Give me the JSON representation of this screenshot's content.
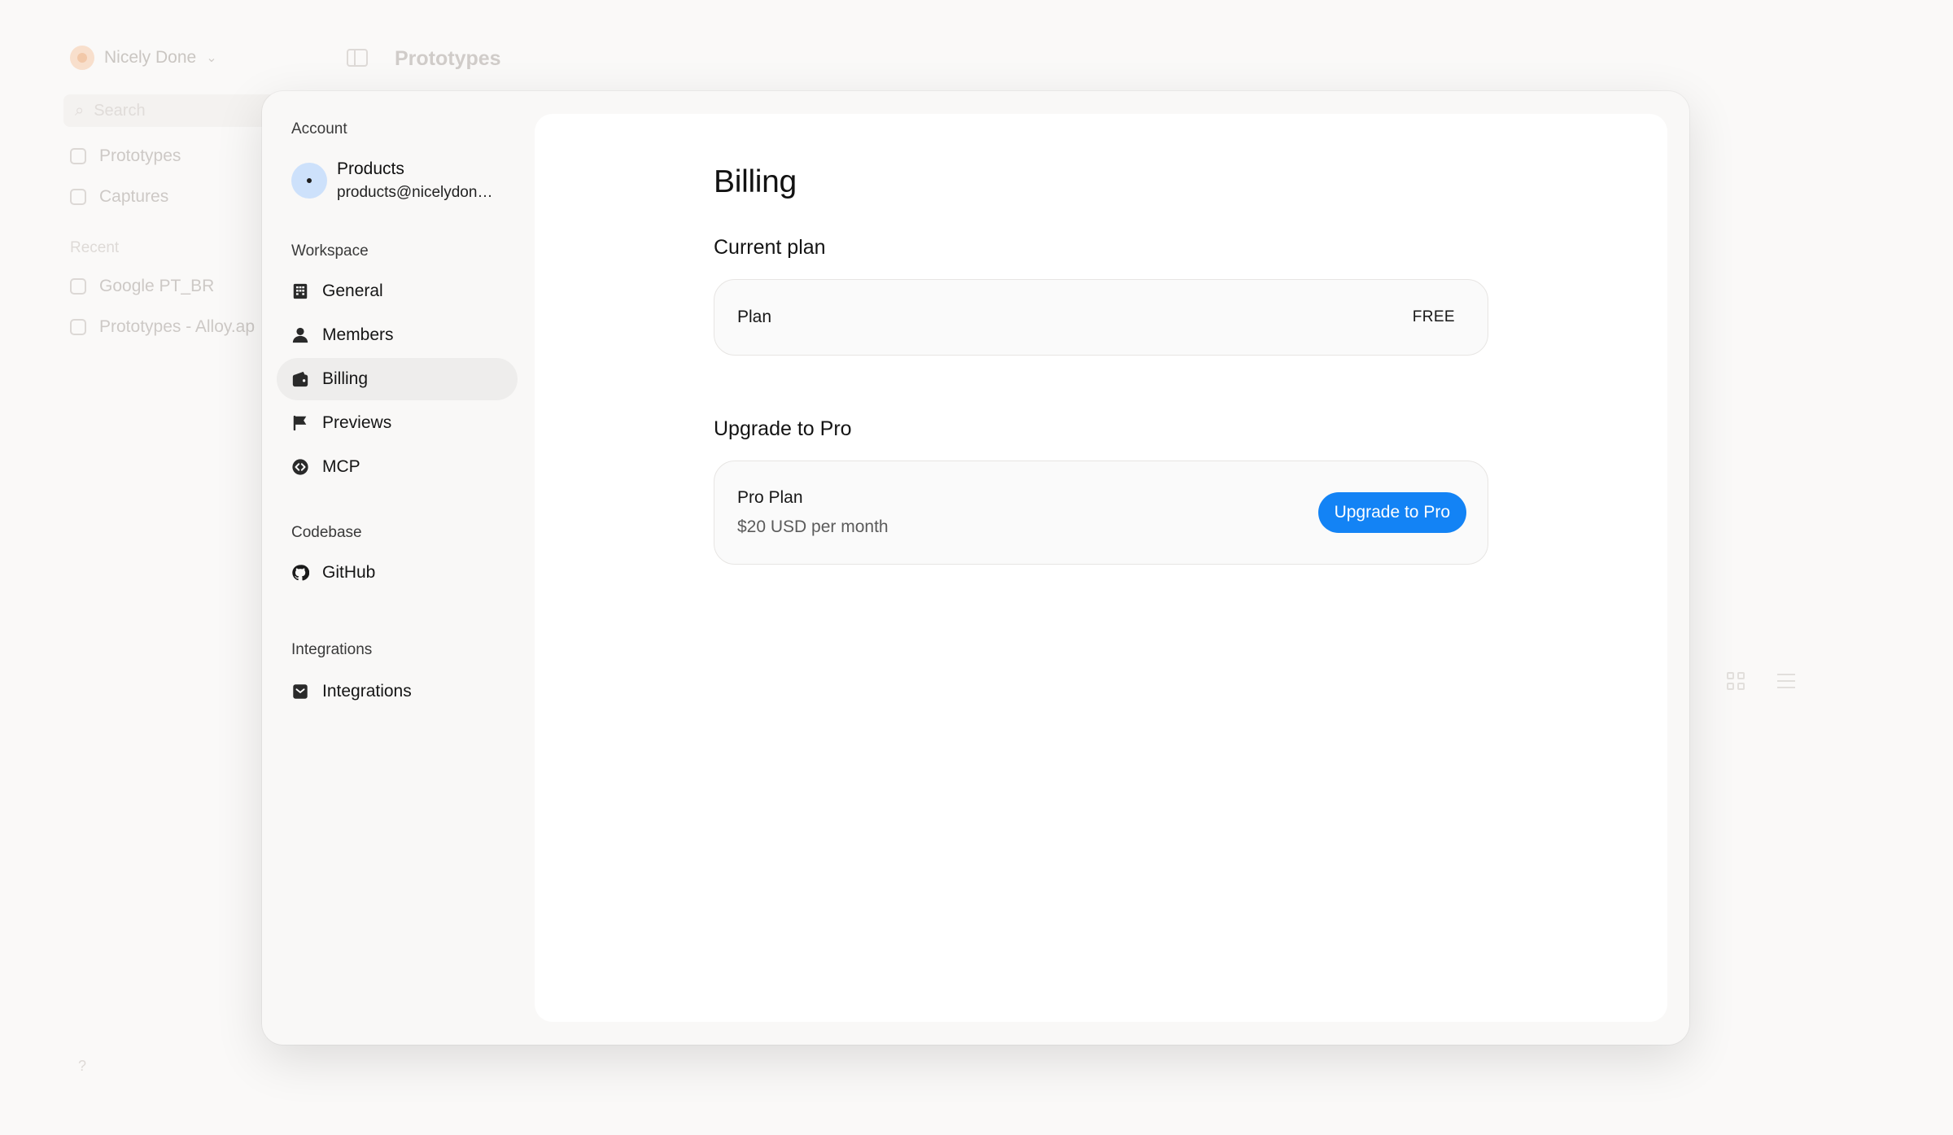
{
  "background": {
    "workspace_name": "Nicely Done",
    "page_title": "Prototypes",
    "search_placeholder": "Search",
    "nav": [
      {
        "label": "Prototypes"
      },
      {
        "label": "Captures"
      }
    ],
    "recent_label": "Recent",
    "recent_items": [
      {
        "label": "Google PT_BR"
      },
      {
        "label": "Prototypes - Alloy.ap"
      }
    ],
    "help_label": "?"
  },
  "sidebar": {
    "account_section": "Account",
    "account": {
      "name": "Products",
      "email": "products@nicelydone.club"
    },
    "workspace_section": "Workspace",
    "workspace_items": [
      {
        "label": "General",
        "icon": "building-icon"
      },
      {
        "label": "Members",
        "icon": "person-icon"
      },
      {
        "label": "Billing",
        "icon": "wallet-icon",
        "active": true
      },
      {
        "label": "Previews",
        "icon": "flag-icon"
      },
      {
        "label": "MCP",
        "icon": "code-circle-icon"
      }
    ],
    "codebase_section": "Codebase",
    "codebase_items": [
      {
        "label": "GitHub",
        "icon": "github-icon"
      }
    ],
    "integrations_section": "Integrations",
    "integrations_items": [
      {
        "label": "Integrations",
        "icon": "integrations-icon"
      }
    ]
  },
  "billing": {
    "title": "Billing",
    "current_plan_heading": "Current plan",
    "plan_label": "Plan",
    "plan_value": "FREE",
    "upgrade_heading": "Upgrade to Pro",
    "pro_plan_name": "Pro Plan",
    "pro_plan_price": "$20 USD per month",
    "upgrade_button": "Upgrade to Pro"
  },
  "colors": {
    "accent": "#1383f5",
    "active_nav": "#eeedec",
    "avatar": "#cde1fb"
  }
}
